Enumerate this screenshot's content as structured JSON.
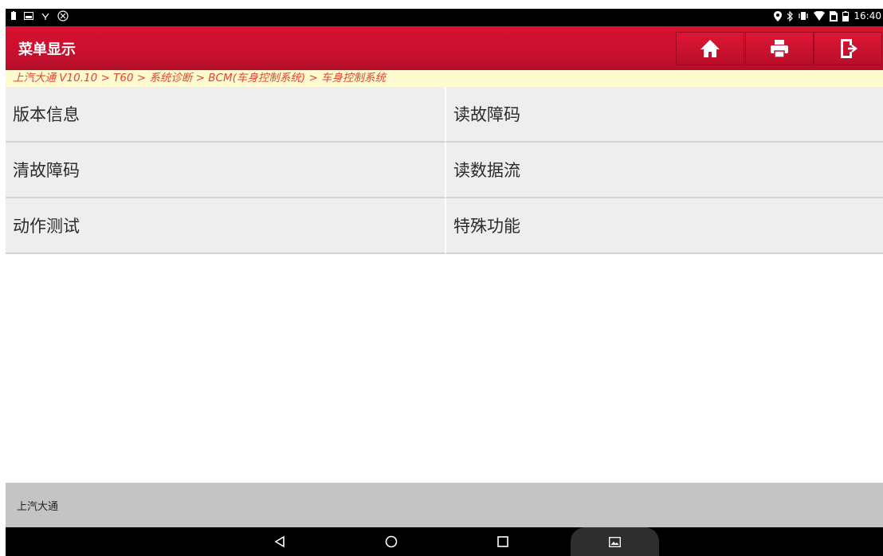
{
  "status_bar": {
    "left_icons": [
      "battery-alert-icon",
      "image-icon",
      "usb-icon",
      "bluetooth-off-icon"
    ],
    "right_icons": [
      "location-icon",
      "bluetooth-icon",
      "vibrate-icon",
      "wifi-icon",
      "sim-icon",
      "battery-icon"
    ],
    "time": "16:40"
  },
  "header": {
    "title": "菜单显示",
    "buttons": [
      "home-icon",
      "print-icon",
      "exit-icon"
    ],
    "accent_color": "#c8102e"
  },
  "breadcrumb": "上汽大通 V10.10 > T60 > 系统诊断 > BCM(车身控制系统) > 车身控制系统",
  "menu": {
    "items": [
      {
        "label": "版本信息"
      },
      {
        "label": "读故障码"
      },
      {
        "label": "清故障码"
      },
      {
        "label": "读数据流"
      },
      {
        "label": "动作测试"
      },
      {
        "label": "特殊功能"
      }
    ]
  },
  "footer": {
    "text": "上汽大通"
  },
  "nav_bar": {
    "buttons": [
      "back-icon",
      "home-circle-icon",
      "recents-icon",
      "screenshot-icon"
    ]
  }
}
